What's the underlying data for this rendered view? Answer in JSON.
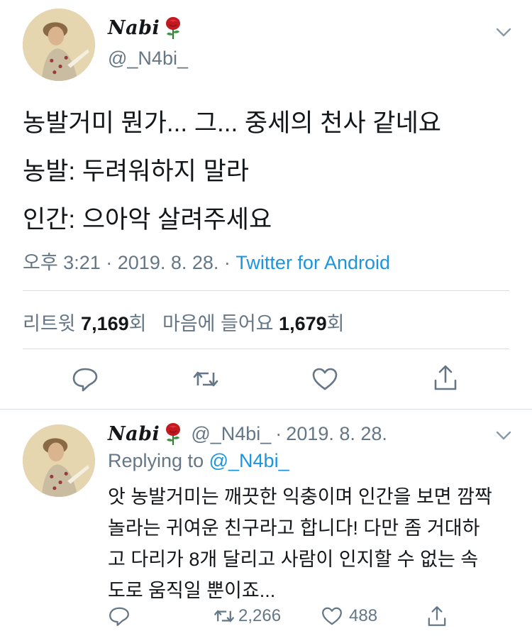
{
  "main_tweet": {
    "display_name": "Nabi",
    "name_emoji": "rose-icon",
    "handle": "@_N4bi_",
    "lines": [
      "농발거미 뭔가... 그... 중세의 천사 같네요",
      "농발: 두려워하지 말라",
      "인간: 으아악 살려주세요"
    ],
    "time": "오후 3:21",
    "sep1": "·",
    "date": "2019. 8. 28.",
    "sep2": "·",
    "source": "Twitter for Android",
    "retweets_label": "리트윗",
    "retweets_count": "7,169",
    "count_suffix": "회",
    "likes_label": "마음에 들어요",
    "likes_count": "1,679",
    "likes_suffix": "회"
  },
  "reply_tweet": {
    "display_name": "Nabi",
    "handle": "@_N4bi_",
    "sep": "·",
    "date": "2019. 8. 28.",
    "replying_label": "Replying to",
    "replying_to": "@_N4bi_",
    "lines": [
      "앗 농발거미는 깨끗한 익충이며 인간을 보면 깜짝",
      "놀라는 귀여운 친구라고 합니다! 다만 좀 거대하",
      "고 다리가 8개 달리고 사람이 인지할 수 없는 속",
      "도로 움직일 뿐이죠..."
    ],
    "retweet_count": "2,266",
    "like_count": "488"
  },
  "colors": {
    "text": "#14171a",
    "secondary": "#657786",
    "link": "#1b95e0",
    "divider": "#d9dee2"
  }
}
